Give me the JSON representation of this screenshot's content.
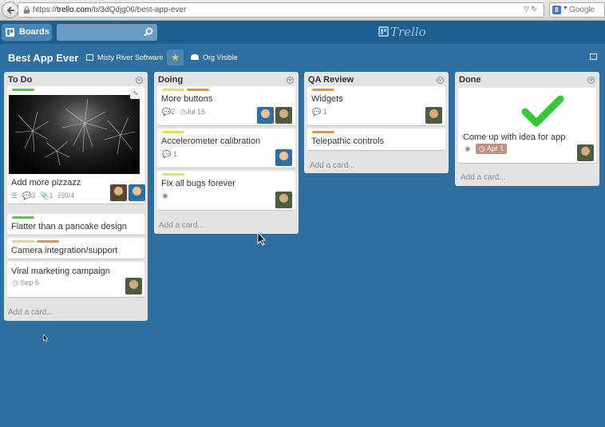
{
  "browser": {
    "url_prefix": "https://",
    "url_domain": "trello.com",
    "url_path": "/b/3dQdjg06/best-app-ever",
    "search_engine": "Google"
  },
  "header": {
    "boards_label": "Boards",
    "logo_text": "Trello"
  },
  "board": {
    "title": "Best App Ever",
    "organization": "Misty River Software",
    "visibility": "Org Visible",
    "starred": true
  },
  "lists": [
    {
      "title": "To Do",
      "add_card": "Add a card...",
      "cards": [
        {
          "title": "Add more pizzazz",
          "has_cover": true,
          "badges": {
            "comments": "3",
            "attachments": "1",
            "checklist": "0/4"
          }
        },
        {
          "title": "Flatter than a pancake design"
        },
        {
          "title": "Camera integration/support"
        },
        {
          "title": "Viral marketing campaign",
          "due": "Sep 5"
        }
      ]
    },
    {
      "title": "Doing",
      "add_card": "Add a card...",
      "cards": [
        {
          "title": "More buttons",
          "badges": {
            "comments": "2",
            "due": "Jul 15"
          }
        },
        {
          "title": "Accelerometer calibration",
          "badges": {
            "comments": "1"
          }
        },
        {
          "title": "Fix all bugs forever"
        }
      ]
    },
    {
      "title": "QA Review",
      "add_card": "Add a card...",
      "cards": [
        {
          "title": "Widgets",
          "badges": {
            "comments": "1"
          }
        },
        {
          "title": "Telepathic controls"
        }
      ]
    },
    {
      "title": "Done",
      "add_card": "Add a card...",
      "cards": [
        {
          "title": "Come up with idea for app",
          "due": "Apr 1"
        }
      ]
    }
  ],
  "colors": {
    "board_bg": "#2e6f9f",
    "label_green": "#61bd4f",
    "label_yellow": "#dfe05e",
    "label_orange": "#e09352",
    "star": "#f2d600"
  }
}
